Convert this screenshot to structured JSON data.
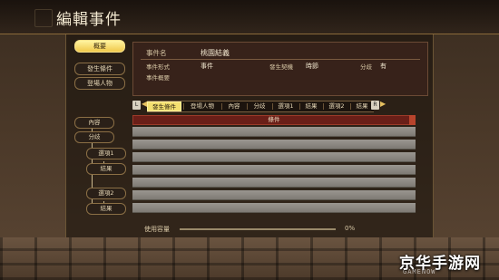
{
  "window": {
    "title": "編輯事件"
  },
  "sidebar": {
    "items": [
      {
        "label": "概要",
        "active": true
      },
      {
        "label": "發生條件",
        "active": false
      },
      {
        "label": "登場人物",
        "active": false
      }
    ]
  },
  "info": {
    "name_label": "事件名",
    "name_value": "桃園結義",
    "form_label": "事件形式",
    "form_value": "事件",
    "timing_label": "發生契機",
    "timing_value": "時節",
    "branch_label": "分歧",
    "branch_value": "有",
    "summary_label": "事件概要"
  },
  "tabs": {
    "left_button": "L",
    "right_button": "R",
    "items": [
      "發生條件",
      "登場人物",
      "內容",
      "分歧",
      "選項1",
      "結果",
      "選項2",
      "結果"
    ]
  },
  "tree": {
    "content": "內容",
    "branch": "分歧",
    "option1": "選項1",
    "result1": "結果",
    "option2": "選項2",
    "result2": "結果"
  },
  "table": {
    "header": "條件"
  },
  "capacity": {
    "label": "使用容量",
    "value": "0%"
  },
  "watermark": {
    "main": "京华手游网",
    "sub": "GAMENOW"
  }
}
